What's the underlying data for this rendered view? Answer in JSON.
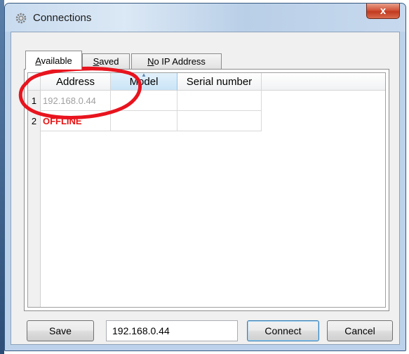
{
  "window": {
    "title": "Connections",
    "close_glyph": "x"
  },
  "tabs": [
    {
      "label": "Available",
      "mnemonic": "A",
      "rest": "vailable",
      "active": true
    },
    {
      "label": "Saved",
      "mnemonic": "S",
      "rest": "aved",
      "active": false
    },
    {
      "label": "No IP Address",
      "mnemonic": "N",
      "rest": "o IP Address",
      "active": false
    }
  ],
  "table": {
    "columns": [
      "Address",
      "Model",
      "Serial number"
    ],
    "sorted_column": "Model",
    "rows": [
      {
        "num": "1",
        "address": "192.168.0.44",
        "model": "",
        "serial": ""
      },
      {
        "num": "2",
        "address": "OFFLINE",
        "model": "",
        "serial": ""
      }
    ]
  },
  "footer": {
    "save_label": "Save",
    "ip_value": "192.168.0.44",
    "connect_label": "Connect",
    "cancel_label": "Cancel"
  },
  "colors": {
    "offline": "#e81414",
    "annotation_ring": "#e8141e",
    "close_button": "#c23a1f"
  },
  "icons": {
    "app": "gear-icon",
    "sort": "sort-ascending-icon"
  }
}
